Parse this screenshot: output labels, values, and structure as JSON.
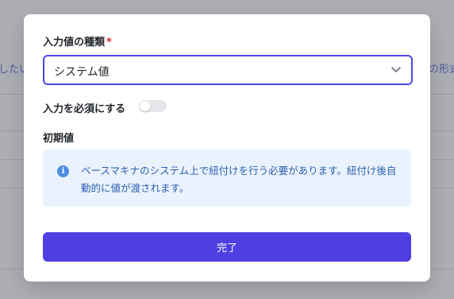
{
  "background": {
    "left_text": "したい",
    "right_text": "の形式"
  },
  "modal": {
    "input_type_label": "入力値の種類",
    "required_mark": "*",
    "select": {
      "value": "システム値"
    },
    "required_toggle": {
      "label": "入力を必須にする",
      "on": false
    },
    "initial_value_label": "初期値",
    "info": {
      "icon": "info-icon",
      "text": "ベースマキナのシステム上で紐付けを行う必要があります。紐付け後自動的に値が渡されます。"
    },
    "done_label": "完了"
  },
  "colors": {
    "accent": "#4f3fe3",
    "info_bg": "#eaf2fd",
    "info_text": "#2a5fb0",
    "required": "#d92c2c"
  }
}
